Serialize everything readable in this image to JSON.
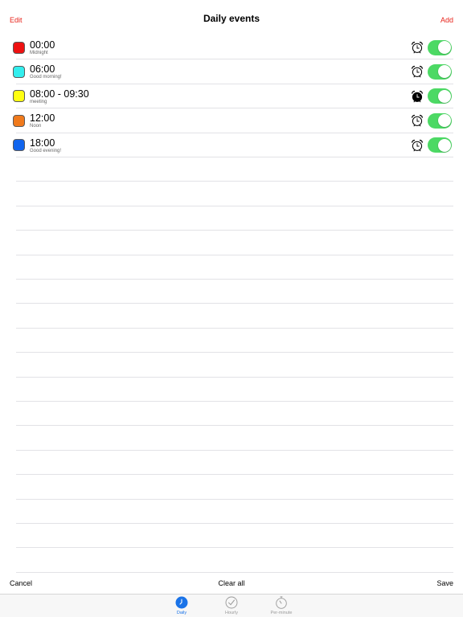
{
  "nav": {
    "left": "Edit",
    "title": "Daily events",
    "right": "Add"
  },
  "events": [
    {
      "time": "00:00",
      "subtitle": "Midnight",
      "color": "#ee1111",
      "alarm_filled": false,
      "enabled": true
    },
    {
      "time": "06:00",
      "subtitle": "Good morning!",
      "color": "#33eeee",
      "alarm_filled": false,
      "enabled": true
    },
    {
      "time": "08:00 - 09:30",
      "subtitle": "meeting",
      "color": "#ffff11",
      "alarm_filled": true,
      "enabled": true
    },
    {
      "time": "12:00",
      "subtitle": "Noon",
      "color": "#f07a1c",
      "alarm_filled": false,
      "enabled": true
    },
    {
      "time": "18:00",
      "subtitle": "Good evening!",
      "color": "#1165ee",
      "alarm_filled": false,
      "enabled": true
    }
  ],
  "bottom": {
    "cancel": "Cancel",
    "clear_all": "Clear all",
    "save": "Save"
  },
  "tabs": [
    {
      "label": "Daily",
      "icon": "clock-icon",
      "active": true
    },
    {
      "label": "Hourly",
      "icon": "check-icon",
      "active": false
    },
    {
      "label": "Per-minute",
      "icon": "stopwatch-icon",
      "active": false
    }
  ],
  "colors": {
    "accent": "#e8251c",
    "toggle_on": "#4cd964",
    "tab_active": "#1a73e8"
  }
}
